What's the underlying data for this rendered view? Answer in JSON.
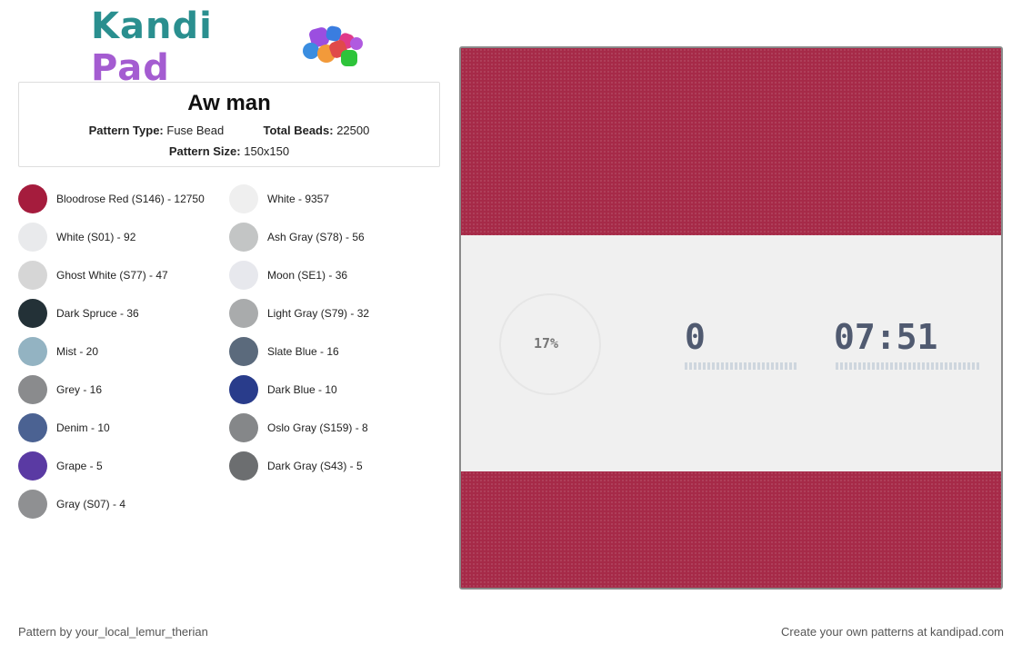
{
  "logo": {
    "part1": "Kandi",
    "part2": "Pad"
  },
  "pattern": {
    "title": "Aw man",
    "type_label": "Pattern Type:",
    "type_value": "Fuse Bead",
    "beads_label": "Total Beads:",
    "beads_value": "22500",
    "size_label": "Pattern Size:",
    "size_value": "150x150"
  },
  "palette": [
    {
      "label": "Bloodrose Red (S146) - 12750",
      "color": "#a51c3d"
    },
    {
      "label": "White - 9357",
      "color": "#efefef"
    },
    {
      "label": "White (S01) - 92",
      "color": "#e9eaec"
    },
    {
      "label": "Ash Gray (S78) - 56",
      "color": "#c3c5c5"
    },
    {
      "label": "Ghost White (S77) - 47",
      "color": "#d6d6d6"
    },
    {
      "label": "Moon (SE1) - 36",
      "color": "#e7e8ed"
    },
    {
      "label": "Dark Spruce - 36",
      "color": "#233137"
    },
    {
      "label": "Light Gray (S79) - 32",
      "color": "#a9abac"
    },
    {
      "label": "Mist - 20",
      "color": "#93b3c2"
    },
    {
      "label": "Slate Blue - 16",
      "color": "#5b6a7c"
    },
    {
      "label": "Grey - 16",
      "color": "#8a8b8d"
    },
    {
      "label": "Dark Blue - 10",
      "color": "#293c8b"
    },
    {
      "label": "Denim - 10",
      "color": "#4b6292"
    },
    {
      "label": "Oslo Gray (S159) - 8",
      "color": "#858789"
    },
    {
      "label": "Grape - 5",
      "color": "#5a3aa3"
    },
    {
      "label": "Dark Gray (S43) - 5",
      "color": "#6c6e70"
    },
    {
      "label": "Gray (S07) - 4",
      "color": "#8f9092"
    }
  ],
  "board": {
    "percent": "17%",
    "count": "0",
    "time": "07:51",
    "red": "#a62a48",
    "light": "#f0f0f0"
  },
  "footer": {
    "left": "Pattern by your_local_lemur_therian",
    "right": "Create your own patterns at kandipad.com"
  }
}
